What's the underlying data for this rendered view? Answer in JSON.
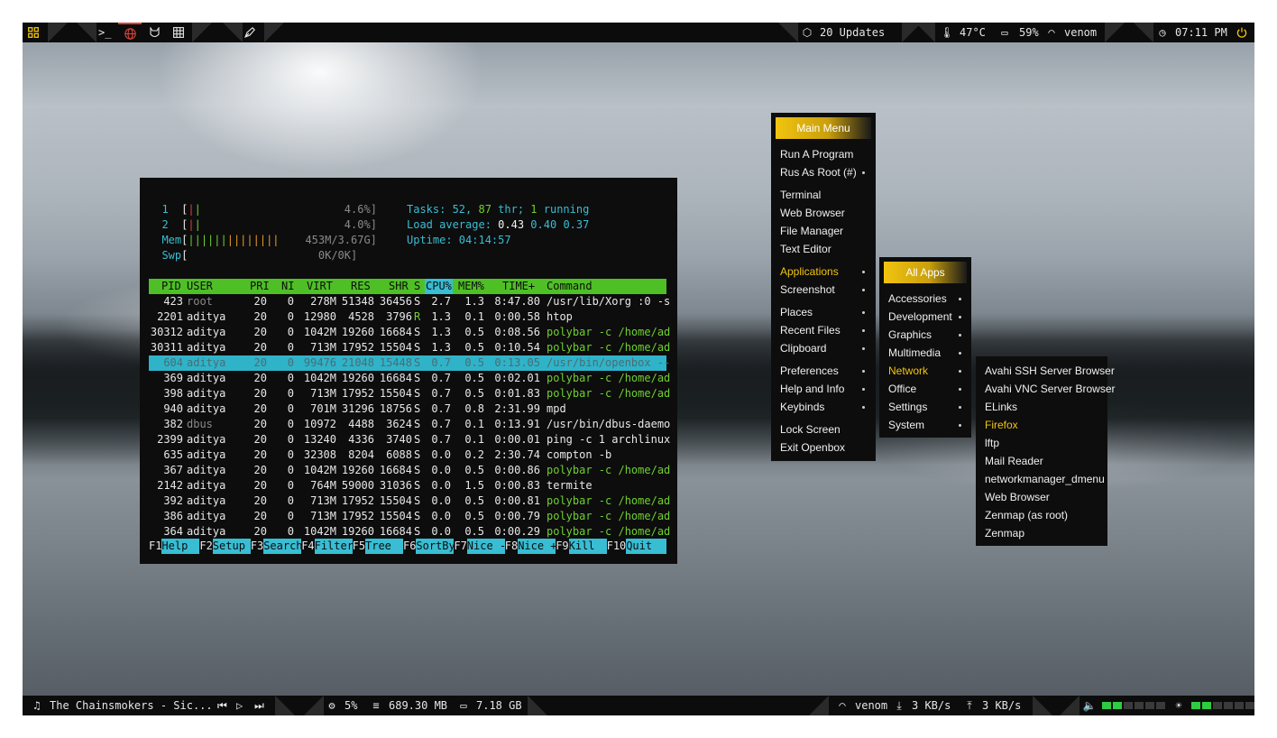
{
  "topbar": {
    "left_icons": [
      "grid-icon",
      "terminal-icon",
      "globe-icon",
      "firefox-icon",
      "spreadsheet-icon",
      "pen-icon"
    ],
    "updates": "20 Updates",
    "temperature": "47°C",
    "battery": "59%",
    "wifi": "venom",
    "clock": "07:11 PM",
    "power_icon": "power-icon",
    "accent": "#f1c40f"
  },
  "bottombar": {
    "music": "The Chainsmokers - Sic...",
    "cpu": "5%",
    "memory": "689.30 MB",
    "disk": "7.18 GB",
    "net_name": "venom",
    "download": "3 KB/s",
    "upload": "3 KB/s",
    "volume_level": 0.4,
    "brightness_level": 0.4
  },
  "htop": {
    "cpu1_label": "1",
    "cpu1_pct": "4.6%]",
    "cpu2_label": "2",
    "cpu2_pct": "4.0%]",
    "mem_label": "Mem",
    "mem_val": "453M/3.67G]",
    "swp_label": "Swp",
    "swp_val": "0K/0K]",
    "tasks_label": "Tasks: ",
    "tasks_val": "52",
    "tasks_thr": "87",
    "tasks_running": "1",
    "load_label": "Load average: ",
    "load1": "0.43",
    "load5": "0.40",
    "load15": "0.37",
    "uptime_label": "Uptime: ",
    "uptime": "04:14:57",
    "columns": [
      "PID",
      "USER",
      "PRI",
      "NI",
      "VIRT",
      "RES",
      "SHR",
      "S",
      "CPU%",
      "MEM%",
      "TIME+",
      "Command"
    ],
    "rows": [
      [
        "423",
        "root",
        "20",
        "0",
        "278M",
        "51348",
        "36456",
        "S",
        "2.7",
        "1.3",
        "8:47.80",
        "/usr/lib/Xorg :0 -s"
      ],
      [
        "2201",
        "aditya",
        "20",
        "0",
        "12980",
        "4528",
        "3796",
        "R",
        "1.3",
        "0.1",
        "0:00.58",
        "htop"
      ],
      [
        "30312",
        "aditya",
        "20",
        "0",
        "1042M",
        "19260",
        "16684",
        "S",
        "1.3",
        "0.5",
        "0:08.56",
        "polybar -c /home/ad"
      ],
      [
        "30311",
        "aditya",
        "20",
        "0",
        "713M",
        "17952",
        "15504",
        "S",
        "1.3",
        "0.5",
        "0:10.54",
        "polybar -c /home/ad"
      ],
      [
        "604",
        "aditya",
        "20",
        "0",
        "99476",
        "21048",
        "15448",
        "S",
        "0.7",
        "0.5",
        "0:13.05",
        "/usr/bin/openbox --"
      ],
      [
        "369",
        "aditya",
        "20",
        "0",
        "1042M",
        "19260",
        "16684",
        "S",
        "0.7",
        "0.5",
        "0:02.01",
        "polybar -c /home/ad"
      ],
      [
        "398",
        "aditya",
        "20",
        "0",
        "713M",
        "17952",
        "15504",
        "S",
        "0.7",
        "0.5",
        "0:01.83",
        "polybar -c /home/ad"
      ],
      [
        "940",
        "aditya",
        "20",
        "0",
        "701M",
        "31296",
        "18756",
        "S",
        "0.7",
        "0.8",
        "2:31.99",
        "mpd"
      ],
      [
        "382",
        "dbus",
        "20",
        "0",
        "10972",
        "4488",
        "3624",
        "S",
        "0.7",
        "0.1",
        "0:13.91",
        "/usr/bin/dbus-daemo"
      ],
      [
        "2399",
        "aditya",
        "20",
        "0",
        "13240",
        "4336",
        "3740",
        "S",
        "0.7",
        "0.1",
        "0:00.01",
        "ping -c 1 archlinux"
      ],
      [
        "635",
        "aditya",
        "20",
        "0",
        "32308",
        "8204",
        "6088",
        "S",
        "0.0",
        "0.2",
        "2:30.74",
        "compton -b"
      ],
      [
        "367",
        "aditya",
        "20",
        "0",
        "1042M",
        "19260",
        "16684",
        "S",
        "0.0",
        "0.5",
        "0:00.86",
        "polybar -c /home/ad"
      ],
      [
        "2142",
        "aditya",
        "20",
        "0",
        "764M",
        "59000",
        "31036",
        "S",
        "0.0",
        "1.5",
        "0:00.83",
        "termite"
      ],
      [
        "392",
        "aditya",
        "20",
        "0",
        "713M",
        "17952",
        "15504",
        "S",
        "0.0",
        "0.5",
        "0:00.81",
        "polybar -c /home/ad"
      ],
      [
        "386",
        "aditya",
        "20",
        "0",
        "713M",
        "17952",
        "15504",
        "S",
        "0.0",
        "0.5",
        "0:00.79",
        "polybar -c /home/ad"
      ],
      [
        "364",
        "aditya",
        "20",
        "0",
        "1042M",
        "19260",
        "16684",
        "S",
        "0.0",
        "0.5",
        "0:00.29",
        "polybar -c /home/ad"
      ]
    ],
    "selected_row": 4,
    "fkeys": [
      [
        "F1",
        "Help"
      ],
      [
        "F2",
        "Setup"
      ],
      [
        "F3",
        "Search"
      ],
      [
        "F4",
        "Filter"
      ],
      [
        "F5",
        "Tree"
      ],
      [
        "F6",
        "SortBy"
      ],
      [
        "F7",
        "Nice -"
      ],
      [
        "F8",
        "Nice +"
      ],
      [
        "F9",
        "Kill"
      ],
      [
        "F10",
        "Quit"
      ]
    ]
  },
  "main_menu": {
    "title": "Main Menu",
    "items": [
      "Run A Program",
      "Rus As Root (#)",
      "Terminal",
      "Web Browser",
      "File Manager",
      "Text Editor",
      "Applications",
      "Screenshot",
      "Places",
      "Recent Files",
      "Clipboard",
      "Preferences",
      "Help and Info",
      "Keybinds",
      "Lock Screen",
      "Exit Openbox"
    ]
  },
  "apps_menu": {
    "title": "All Apps",
    "items": [
      "Accessories",
      "Development",
      "Graphics",
      "Multimedia",
      "Network",
      "Office",
      "Settings",
      "System"
    ]
  },
  "network_menu": {
    "items": [
      "Avahi SSH Server Browser",
      "Avahi VNC Server Browser",
      "ELinks",
      "Firefox",
      "lftp",
      "Mail Reader",
      "networkmanager_dmenu",
      "Web Browser",
      "Zenmap (as root)",
      "Zenmap"
    ]
  }
}
